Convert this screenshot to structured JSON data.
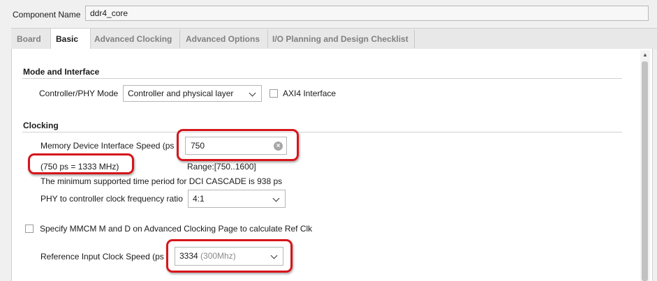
{
  "component": {
    "label": "Component Name",
    "value": "ddr4_core"
  },
  "tabs": [
    {
      "label": "Board"
    },
    {
      "label": "Basic"
    },
    {
      "label": "Advanced Clocking"
    },
    {
      "label": "Advanced Options"
    },
    {
      "label": "I/O Planning and Design Checklist"
    }
  ],
  "mode": {
    "title": "Mode and Interface",
    "controller_label": "Controller/PHY Mode",
    "controller_value": "Controller and physical layer",
    "axi_label": "AXI4 Interface"
  },
  "clocking": {
    "title": "Clocking",
    "speed_label": "Memory Device Interface Speed (ps",
    "speed_value": "750",
    "speed_conversion": "(750 ps = 1333 MHz)",
    "range": "Range:[750..1600]",
    "note": "The minimum supported time period for DCI CASCADE is 938 ps",
    "ratio_label": "PHY to controller clock frequency ratio",
    "ratio_value": "4:1",
    "mmcm_label": "Specify MMCM M and D on Advanced Clocking Page to calculate Ref Clk",
    "ref_label": "Reference Input Clock Speed (ps",
    "ref_value": "3334",
    "ref_hint": "(300Mhz)"
  },
  "colors": {
    "highlight": "#d7151b",
    "active_tab_bg": "#ffffff",
    "window_bg": "#f0f0f0"
  }
}
